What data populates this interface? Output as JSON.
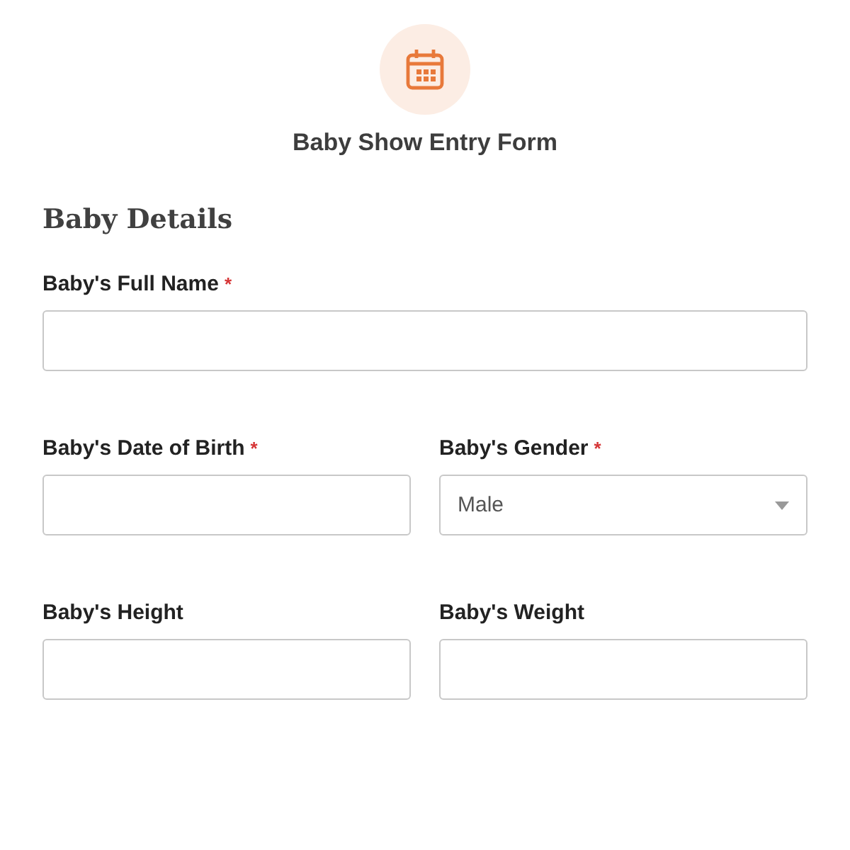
{
  "form": {
    "title": "Baby Show Entry Form"
  },
  "section": {
    "title": "Baby Details"
  },
  "rows": [
    [
      {
        "kind": "text",
        "label": "Baby's Full Name",
        "required_mark": "*"
      }
    ],
    [
      {
        "kind": "text",
        "label": "Baby's Date of Birth",
        "required_mark": "*"
      },
      {
        "kind": "select",
        "label": "Baby's Gender",
        "required_mark": "*",
        "value": "Male"
      }
    ],
    [
      {
        "kind": "text",
        "label": "Baby's Height"
      },
      {
        "kind": "text",
        "label": "Baby's Weight"
      }
    ]
  ]
}
